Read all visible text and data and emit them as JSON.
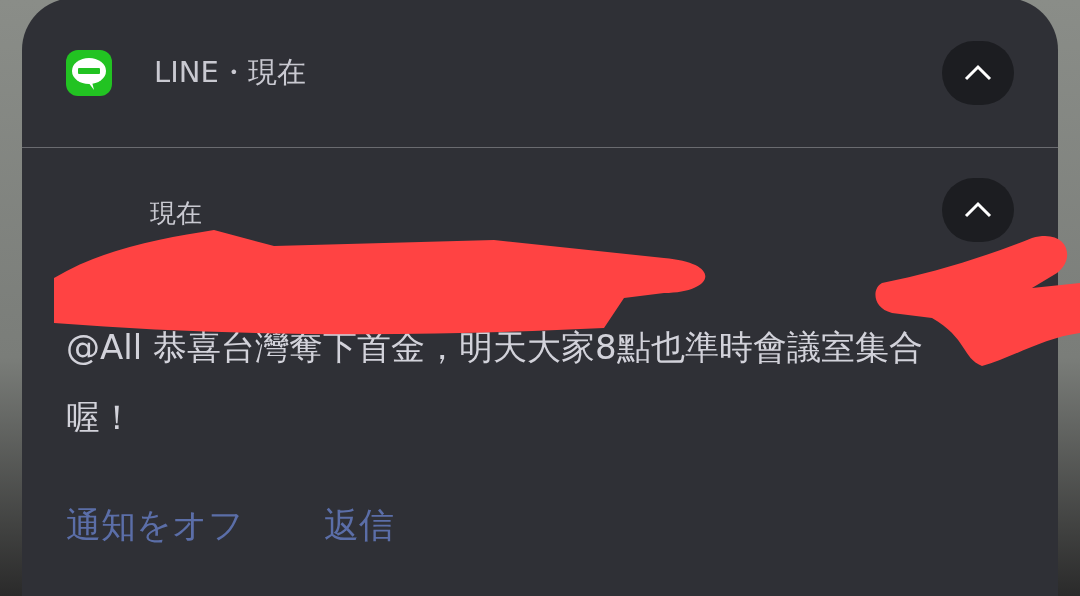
{
  "header": {
    "app_name": "LINE・現在",
    "expanded": true
  },
  "message": {
    "time": "現在",
    "expanded": true,
    "text": "@All 恭喜台灣奪下首金，明天大家8點也準時會議室集合喔！"
  },
  "actions": [
    "通知をオフ",
    "返信"
  ]
}
